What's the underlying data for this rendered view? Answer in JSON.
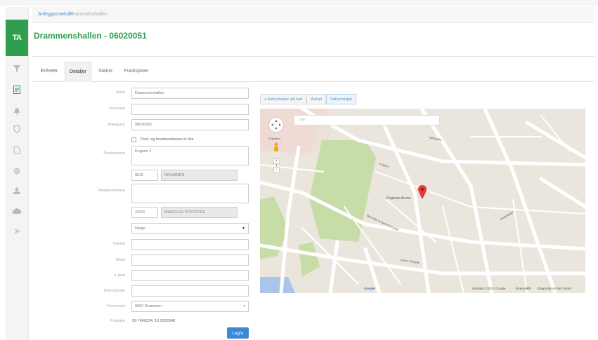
{
  "breadcrumb": {
    "link": "Anleggsoversikt",
    "separator": "/",
    "current": "Drammenshallen"
  },
  "page_title": "Drammenshallen - 06020051",
  "tabs": [
    {
      "label": "Enheter",
      "active": false
    },
    {
      "label": "Detaljer",
      "active": true
    },
    {
      "label": "Status",
      "active": false
    },
    {
      "label": "Funksjoner",
      "active": false
    }
  ],
  "form": {
    "navn": {
      "label": "Navn",
      "value": "Drammenshallen"
    },
    "kortnavn": {
      "label": "Kortnavn",
      "value": ""
    },
    "anleggsnr": {
      "label": "Anleggsnr",
      "value": "06020051"
    },
    "same_address_label": "Post- og besøksadresse er like",
    "postadresse": {
      "label": "Postadresse",
      "value": "Engene 1"
    },
    "post_postnr": "3015",
    "post_poststed": "DRAMMEN",
    "besoksadresse": {
      "label": "Besøksadresse",
      "value": ""
    },
    "besok_postnr": "XXXX",
    "besok_poststed": "MANGLER POSTSTED",
    "land": {
      "value": "Norge"
    },
    "telefon": {
      "label": "Telefon",
      "value": ""
    },
    "mobil": {
      "label": "Mobil",
      "value": ""
    },
    "epost": {
      "label": "E-post",
      "value": ""
    },
    "internettside": {
      "label": "Internettside",
      "value": ""
    },
    "kommune": {
      "label": "Kommune",
      "value": "0602 Drammen"
    },
    "posisjon": {
      "label": "Posisjon",
      "value": "59.7466234, 10.2083348"
    },
    "save_label": "Lagre"
  },
  "map": {
    "toolbar": {
      "set_from_map": "Sett posisjon på kart",
      "cancel": "Avbryt",
      "set_position": "Sett posisjon"
    },
    "search_placeholder": "Søk",
    "marker_label": "Engenes Arena",
    "footer_data": "Kartdata ©2014 Google",
    "footer_terms": "Bruksvilkår",
    "footer_report": "Rapporter en feil i kartet",
    "logo_text": "Google",
    "street_labels": [
      "Grønland",
      "Bjørnstjerne Bjørnsons gate",
      "Engene",
      "Tollbugata",
      "Nedre Storgate",
      "Haugesgate"
    ]
  },
  "colors": {
    "brand_green": "#2f9e4f",
    "link_blue": "#4a8fcf",
    "primary_button": "#3a89d8",
    "map_road": "#ffffff",
    "map_park": "#c8dca8",
    "map_ground": "#ebe6dd"
  },
  "icons": {
    "sidebar": [
      "filter-icon",
      "list-icon",
      "bell-icon",
      "shield-icon",
      "document-icon",
      "gear-icon",
      "user-icon",
      "cloud-icon",
      "expand-chevron-icon"
    ],
    "map": [
      "pan-control-icon",
      "pegman-icon",
      "zoom-in-icon",
      "zoom-out-icon",
      "map-marker-icon",
      "select-caret-icon"
    ]
  }
}
